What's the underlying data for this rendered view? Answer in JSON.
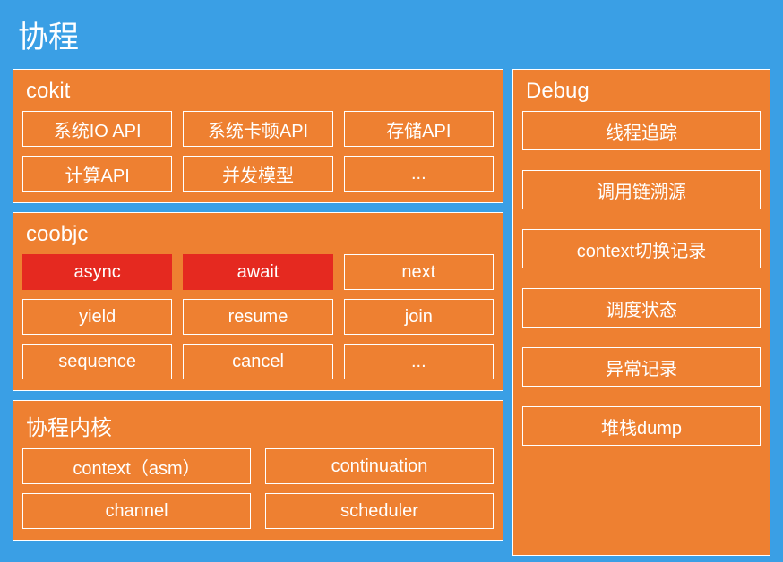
{
  "title": "协程",
  "left": {
    "cokit": {
      "title": "cokit",
      "cells": [
        "系统IO API",
        "系统卡顿API",
        "存储API",
        "计算API",
        "并发模型",
        "..."
      ]
    },
    "coobjc": {
      "title": "coobjc",
      "cells": [
        {
          "label": "async",
          "hl": true
        },
        {
          "label": "await",
          "hl": true
        },
        {
          "label": "next",
          "hl": false
        },
        {
          "label": "yield",
          "hl": false
        },
        {
          "label": "resume",
          "hl": false
        },
        {
          "label": "join",
          "hl": false
        },
        {
          "label": "sequence",
          "hl": false
        },
        {
          "label": "cancel",
          "hl": false
        },
        {
          "label": "...",
          "hl": false
        }
      ]
    },
    "kernel": {
      "title": "协程内核",
      "cells": [
        "context（asm）",
        "continuation",
        "channel",
        "scheduler"
      ]
    }
  },
  "right": {
    "debug": {
      "title": "Debug",
      "cells": [
        "线程追踪",
        "调用链溯源",
        "context切换记录",
        "调度状态",
        "异常记录",
        "堆栈dump"
      ]
    }
  }
}
